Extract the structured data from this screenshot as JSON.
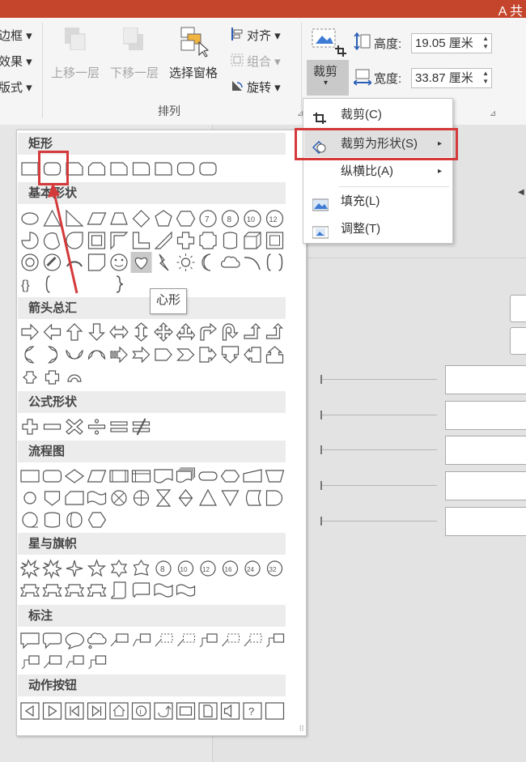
{
  "titlebar": {
    "text": "A 共"
  },
  "ribbon": {
    "left_items": [
      "边框 ▾",
      "效果 ▾",
      "版式 ▾"
    ],
    "arrange": {
      "bring_forward": "上移一层",
      "send_backward": "下移一层",
      "selection_pane": "选择窗格",
      "align": "对齐 ▾",
      "group": "组合 ▾",
      "rotate": "旋转 ▾",
      "group_label": "排列"
    },
    "size": {
      "crop_label": "裁剪",
      "crop_dropdown": "▾",
      "height_label": "高度:",
      "height_value": "19.05 厘米",
      "width_label": "宽度:",
      "width_value": "33.87 厘米"
    }
  },
  "crop_menu": {
    "items": [
      {
        "label": "裁剪(C)",
        "icon": "crop-icon",
        "submenu": ""
      },
      {
        "label": "裁剪为形状(S)",
        "icon": "crop-to-shape-icon",
        "submenu": "▸"
      },
      {
        "label": "纵横比(A)",
        "icon": "",
        "submenu": "▸"
      },
      {
        "label": "填充(L)",
        "icon": "fill-icon",
        "submenu": ""
      },
      {
        "label": "调整(T)",
        "icon": "fit-icon",
        "submenu": ""
      }
    ],
    "highlight_color": "#d43a3a"
  },
  "gallery": {
    "categories": [
      "矩形",
      "基本形状",
      "箭头总汇",
      "公式形状",
      "流程图",
      "星与旗帜",
      "标注",
      "动作按钮"
    ],
    "tooltip": "心形",
    "highlighted_shape": "rounded-rectangle",
    "hovered_shape": "heart",
    "basic_shape_text": "{ }"
  },
  "colors": {
    "titlebar": "#c4442c",
    "annotation_red": "#d43a3a"
  }
}
